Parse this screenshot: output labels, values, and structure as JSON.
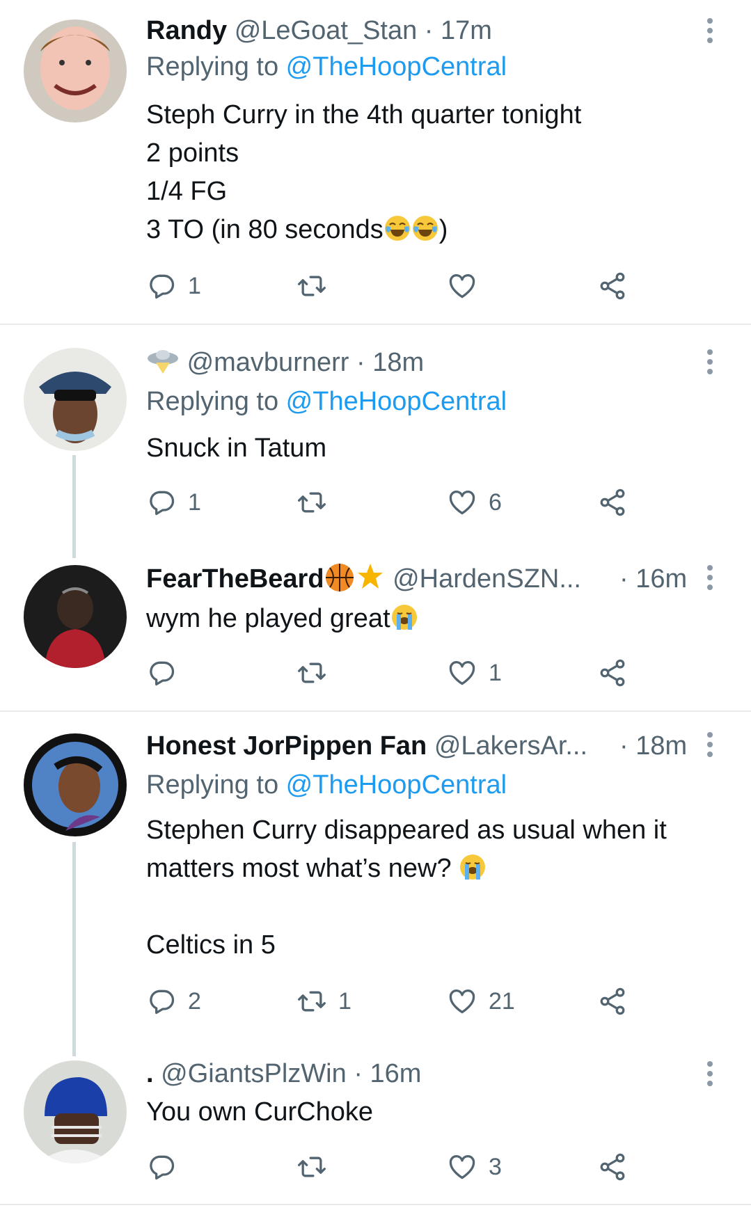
{
  "tweets": [
    {
      "name": "Randy",
      "handle": "@LeGoat_Stan",
      "time": "· 17m",
      "replying_prefix": "Replying to ",
      "replying_to": "@TheHoopCentral",
      "lines": [
        "Steph Curry in the 4th quarter tonight",
        "2 points",
        "1/4 FG",
        "3 TO (in 80 seconds"
      ],
      "line_end": ")",
      "replies": "1",
      "retweets": "",
      "likes": ""
    },
    {
      "name": "",
      "handle": "@mavburnerr",
      "time": "· 18m",
      "replying_prefix": "Replying to ",
      "replying_to": "@TheHoopCentral",
      "lines": [
        "Snuck in Tatum"
      ],
      "replies": "1",
      "retweets": "",
      "likes": "6"
    },
    {
      "name": "FearTheBeard",
      "handle": "@HardenSZN...",
      "time": "· 16m",
      "lines": [
        "wym he played great"
      ],
      "replies": "",
      "retweets": "",
      "likes": "1"
    },
    {
      "name": "Honest JorPippen Fan",
      "handle": "@LakersAr...",
      "time": "· 18m",
      "replying_prefix": "Replying to ",
      "replying_to": "@TheHoopCentral",
      "lines": [
        "Stephen Curry disappeared as usual when it",
        "matters most what’s new? ",
        "",
        "Celtics in 5"
      ],
      "replies": "2",
      "retweets": "1",
      "likes": "21"
    },
    {
      "name": ".",
      "handle": "@GiantsPlzWin",
      "time": "· 16m",
      "lines": [
        "You own CurChoke"
      ],
      "replies": "",
      "retweets": "",
      "likes": "3"
    }
  ],
  "icons": [
    "reply-icon",
    "retweet-icon",
    "like-icon",
    "share-icon",
    "more-options-icon"
  ],
  "colors": {
    "text": "#0f1419",
    "muted": "#536471",
    "link": "#1d9bf0",
    "divider": "#e7e9ea"
  }
}
